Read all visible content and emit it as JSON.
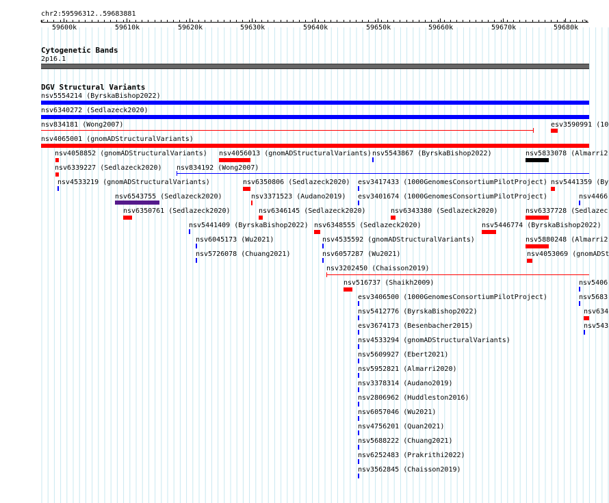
{
  "location": "chr2:59596312..59683881",
  "ruler_ticks": [
    "59600k",
    "59610k",
    "59620k",
    "59630k",
    "59640k",
    "59650k",
    "59660k",
    "59670k",
    "59680k"
  ],
  "cytoband_track": {
    "title": "Cytogenetic Bands",
    "band": "2p16.1"
  },
  "dgv_track": {
    "title": "DGV Structural Variants",
    "labels": [
      "nsv5554214 (ByrskaBishop2022)",
      "nsv6340272 (Sedlazeck2020)",
      "nsv834181 (Wong2007)",
      "esv3590991 (100",
      "nsv4065001 (gnomADStructuralVariants)",
      "nsv4058852 (gnomADStructuralVariants)",
      "nsv4056013 (gnomADStructuralVariants)",
      "nsv5543867 (ByrskaBishop2022)",
      "nsv5833078 (Almarri2",
      "nsv6339227 (Sedlazeck2020)",
      "nsv834192 (Wong2007)",
      "nsv4533219 (gnomADStructuralVariants)",
      "nsv6350806 (Sedlazeck2020)",
      "esv3417433 (1000GenomesConsortiumPilotProject)",
      "nsv5441359 (By",
      "nsv6543755 (Sedlazeck2020)",
      "nsv3371523 (Audano2019)",
      "esv3401674 (1000GenomesConsortiumPilotProject)",
      "nsv4466",
      "nsv6350761 (Sedlazeck2020)",
      "nsv6346145 (Sedlazeck2020)",
      "nsv6343380 (Sedlazeck2020)",
      "nsv6337728 (Sedlazec",
      "nsv5441409 (ByrskaBishop2022)",
      "nsv6348555 (Sedlazeck2020)",
      "nsv5446774 (ByrskaBishop2022)",
      "nsv6045173 (Wu2021)",
      "nsv4535592 (gnomADStructuralVariants)",
      "nsv5880248 (Almarri2",
      "nsv5726078 (Chuang2021)",
      "nsv6057287 (Wu2021)",
      "nsv4053069 (gnomADSt",
      "nsv3202450 (Chaisson2019)",
      "nsv516737 (Shaikh2009)",
      "nsv5406",
      "esv3406500 (1000GenomesConsortiumPilotProject)",
      "nsv5683",
      "nsv5412776 (ByrskaBishop2022)",
      "nsv634",
      "esv3674173 (Besenbacher2015)",
      "nsv543",
      "nsv4533294 (gnomADStructuralVariants)",
      "nsv5609927 (Ebert2021)",
      "nsv5952821 (Almarri2020)",
      "nsv3378314 (Audano2019)",
      "nsv2806962 (Huddleston2016)",
      "nsv6057046 (Wu2021)",
      "nsv4756201 (Quan2021)",
      "nsv5688222 (Chuang2021)",
      "nsv6252483 (Prakrithi2022)",
      "nsv3562845 (Chaisson2019)"
    ]
  },
  "colors": {
    "loss": "#ff0000",
    "gain": "#0000ff",
    "complex": "#000000",
    "inversion": "#551a8b",
    "band": "#666666",
    "grid": "#c8e8f0"
  }
}
